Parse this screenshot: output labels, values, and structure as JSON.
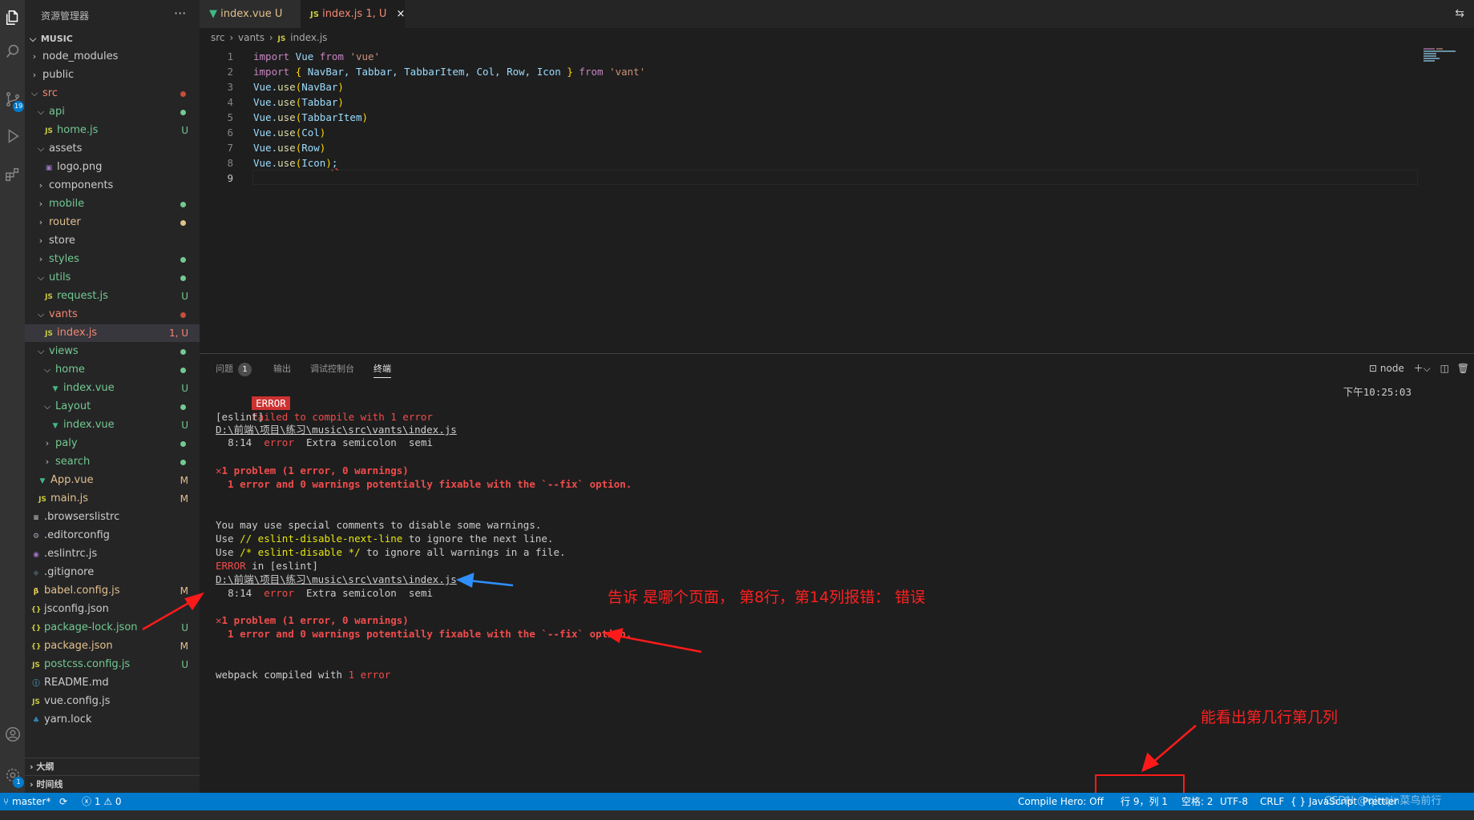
{
  "activity": {
    "scm_badge": "19",
    "settings_badge": "1"
  },
  "sidebar": {
    "title": "资源管理器",
    "more": "···",
    "root": "MUSIC",
    "items": [
      {
        "label": "node_modules",
        "depth": 1,
        "kind": "folder",
        "open": false,
        "status": "",
        "dot": ""
      },
      {
        "label": "public",
        "depth": 1,
        "kind": "folder",
        "open": false,
        "status": "",
        "dot": ""
      },
      {
        "label": "src",
        "depth": 1,
        "kind": "folder",
        "open": true,
        "status": "",
        "dot": "#c74e39",
        "color": "#f48771"
      },
      {
        "label": "api",
        "depth": 2,
        "kind": "folder",
        "open": true,
        "status": "",
        "dot": "#73c991",
        "color": "#73c991"
      },
      {
        "label": "home.js",
        "depth": 3,
        "kind": "js",
        "status": "U",
        "dot": "",
        "color": "#73c991"
      },
      {
        "label": "assets",
        "depth": 2,
        "kind": "folder",
        "open": true,
        "status": "",
        "dot": ""
      },
      {
        "label": "logo.png",
        "depth": 3,
        "kind": "img",
        "status": "",
        "dot": ""
      },
      {
        "label": "components",
        "depth": 2,
        "kind": "folder",
        "open": false,
        "status": "",
        "dot": ""
      },
      {
        "label": "mobile",
        "depth": 2,
        "kind": "folder",
        "open": false,
        "status": "",
        "dot": "#73c991",
        "color": "#73c991"
      },
      {
        "label": "router",
        "depth": 2,
        "kind": "folder",
        "open": false,
        "status": "",
        "dot": "#e2c08d",
        "color": "#e2c08d"
      },
      {
        "label": "store",
        "depth": 2,
        "kind": "folder",
        "open": false,
        "status": "",
        "dot": ""
      },
      {
        "label": "styles",
        "depth": 2,
        "kind": "folder",
        "open": false,
        "status": "",
        "dot": "#73c991",
        "color": "#73c991"
      },
      {
        "label": "utils",
        "depth": 2,
        "kind": "folder",
        "open": true,
        "status": "",
        "dot": "#73c991",
        "color": "#73c991"
      },
      {
        "label": "request.js",
        "depth": 3,
        "kind": "js",
        "status": "U",
        "dot": "",
        "color": "#73c991"
      },
      {
        "label": "vants",
        "depth": 2,
        "kind": "folder",
        "open": true,
        "status": "",
        "dot": "#c74e39",
        "color": "#f48771"
      },
      {
        "label": "index.js",
        "depth": 3,
        "kind": "js",
        "status": "1, U",
        "dot": "",
        "color": "#f48771",
        "selected": true
      },
      {
        "label": "views",
        "depth": 2,
        "kind": "folder",
        "open": true,
        "status": "",
        "dot": "#73c991",
        "color": "#73c991"
      },
      {
        "label": "home",
        "depth": 3,
        "kind": "folder",
        "open": true,
        "status": "",
        "dot": "#73c991",
        "color": "#73c991"
      },
      {
        "label": "index.vue",
        "depth": 4,
        "kind": "vue",
        "status": "U",
        "dot": "",
        "color": "#73c991"
      },
      {
        "label": "Layout",
        "depth": 3,
        "kind": "folder",
        "open": true,
        "status": "",
        "dot": "#73c991",
        "color": "#73c991"
      },
      {
        "label": "index.vue",
        "depth": 4,
        "kind": "vue",
        "status": "U",
        "dot": "",
        "color": "#73c991"
      },
      {
        "label": "paly",
        "depth": 3,
        "kind": "folder",
        "open": false,
        "status": "",
        "dot": "#73c991",
        "color": "#73c991"
      },
      {
        "label": "search",
        "depth": 3,
        "kind": "folder",
        "open": false,
        "status": "",
        "dot": "#73c991",
        "color": "#73c991"
      },
      {
        "label": "App.vue",
        "depth": 2,
        "kind": "vue",
        "status": "M",
        "dot": "",
        "color": "#e2c08d"
      },
      {
        "label": "main.js",
        "depth": 2,
        "kind": "js",
        "status": "M",
        "dot": "",
        "color": "#e2c08d"
      },
      {
        "label": ".browserslistrc",
        "depth": 1,
        "kind": "list",
        "status": "",
        "dot": ""
      },
      {
        "label": ".editorconfig",
        "depth": 1,
        "kind": "gear",
        "status": "",
        "dot": ""
      },
      {
        "label": ".eslintrc.js",
        "depth": 1,
        "kind": "eslint",
        "status": "",
        "dot": ""
      },
      {
        "label": ".gitignore",
        "depth": 1,
        "kind": "git",
        "status": "",
        "dot": ""
      },
      {
        "label": "babel.config.js",
        "depth": 1,
        "kind": "babel",
        "status": "M",
        "dot": "",
        "color": "#e2c08d"
      },
      {
        "label": "jsconfig.json",
        "depth": 1,
        "kind": "json",
        "status": "",
        "dot": ""
      },
      {
        "label": "package-lock.json",
        "depth": 1,
        "kind": "json",
        "status": "U",
        "dot": "",
        "color": "#73c991"
      },
      {
        "label": "package.json",
        "depth": 1,
        "kind": "json",
        "status": "M",
        "dot": "",
        "color": "#e2c08d"
      },
      {
        "label": "postcss.config.js",
        "depth": 1,
        "kind": "js",
        "status": "U",
        "dot": "",
        "color": "#73c991"
      },
      {
        "label": "README.md",
        "depth": 1,
        "kind": "info",
        "status": "",
        "dot": ""
      },
      {
        "label": "vue.config.js",
        "depth": 1,
        "kind": "js",
        "status": "",
        "dot": ""
      },
      {
        "label": "yarn.lock",
        "depth": 1,
        "kind": "yarn",
        "status": "",
        "dot": ""
      }
    ],
    "outline": "大纲",
    "timeline": "时间线"
  },
  "tabs": [
    {
      "label": "index.vue",
      "suffix": "U",
      "kind": "vue"
    },
    {
      "label": "index.js",
      "suffix": "1, U",
      "kind": "js",
      "close": "×"
    }
  ],
  "breadcrumb": [
    "src",
    "vants",
    "index.js"
  ],
  "editor": {
    "lines": [
      "import Vue from 'vue'",
      "import { NavBar, Tabbar, TabbarItem, Col, Row, Icon } from 'vant'",
      "Vue.use(NavBar)",
      "Vue.use(Tabbar)",
      "Vue.use(TabbarItem)",
      "Vue.use(Col)",
      "Vue.use(Row)",
      "Vue.use(Icon);",
      ""
    ],
    "current_line": 9
  },
  "panel": {
    "tabs": [
      {
        "label": "问题",
        "badge": "1"
      },
      {
        "label": "输出"
      },
      {
        "label": "调试控制台"
      },
      {
        "label": "终端",
        "active": true
      }
    ],
    "shell": "node",
    "timestamp": "下午10:25:03",
    "terminal": {
      "error_badge": "ERROR",
      "compile_failed": "Failed to compile with 1 error",
      "eslint_tag": "[eslint]",
      "file_path": "D:\\前端\\项目\\练习\\music\\src\\vants\\index.js",
      "loc": "8:14",
      "level": "error",
      "message": "Extra semicolon",
      "rule": "semi",
      "problem_summary": "1 problem (1 error, 0 warnings)",
      "fixable": "  1 error and 0 warnings potentially fixable with the `--fix` option.",
      "hint1": "You may use special comments to disable some warnings.",
      "hint2_pre": "Use ",
      "hint2_code": "// eslint-disable-next-line",
      "hint2_post": " to ignore the next line.",
      "hint3_pre": "Use ",
      "hint3_code": "/* eslint-disable */",
      "hint3_post": " to ignore all warnings in a file.",
      "error_in_word": "ERROR",
      "error_in_rest": " in [eslint]",
      "webpack_pre": "webpack compiled with ",
      "webpack_err": "1 error"
    }
  },
  "annotations": {
    "note1": "告诉 是哪个页面，   第8行，第14列报错：  错误",
    "note2": "能看出第几行第几列"
  },
  "statusbar": {
    "branch": "master*",
    "errors": "1",
    "warnings": "0",
    "compile_hero": "Compile Hero: Off",
    "position": "行 9，列 1",
    "spaces": "空格: 2",
    "encoding": "UTF-8",
    "eol": "CRLF",
    "language": "{ } JavaScript",
    "prettier": "Prettier",
    "watermark": "CSDN @qinqin菜鸟前行"
  }
}
